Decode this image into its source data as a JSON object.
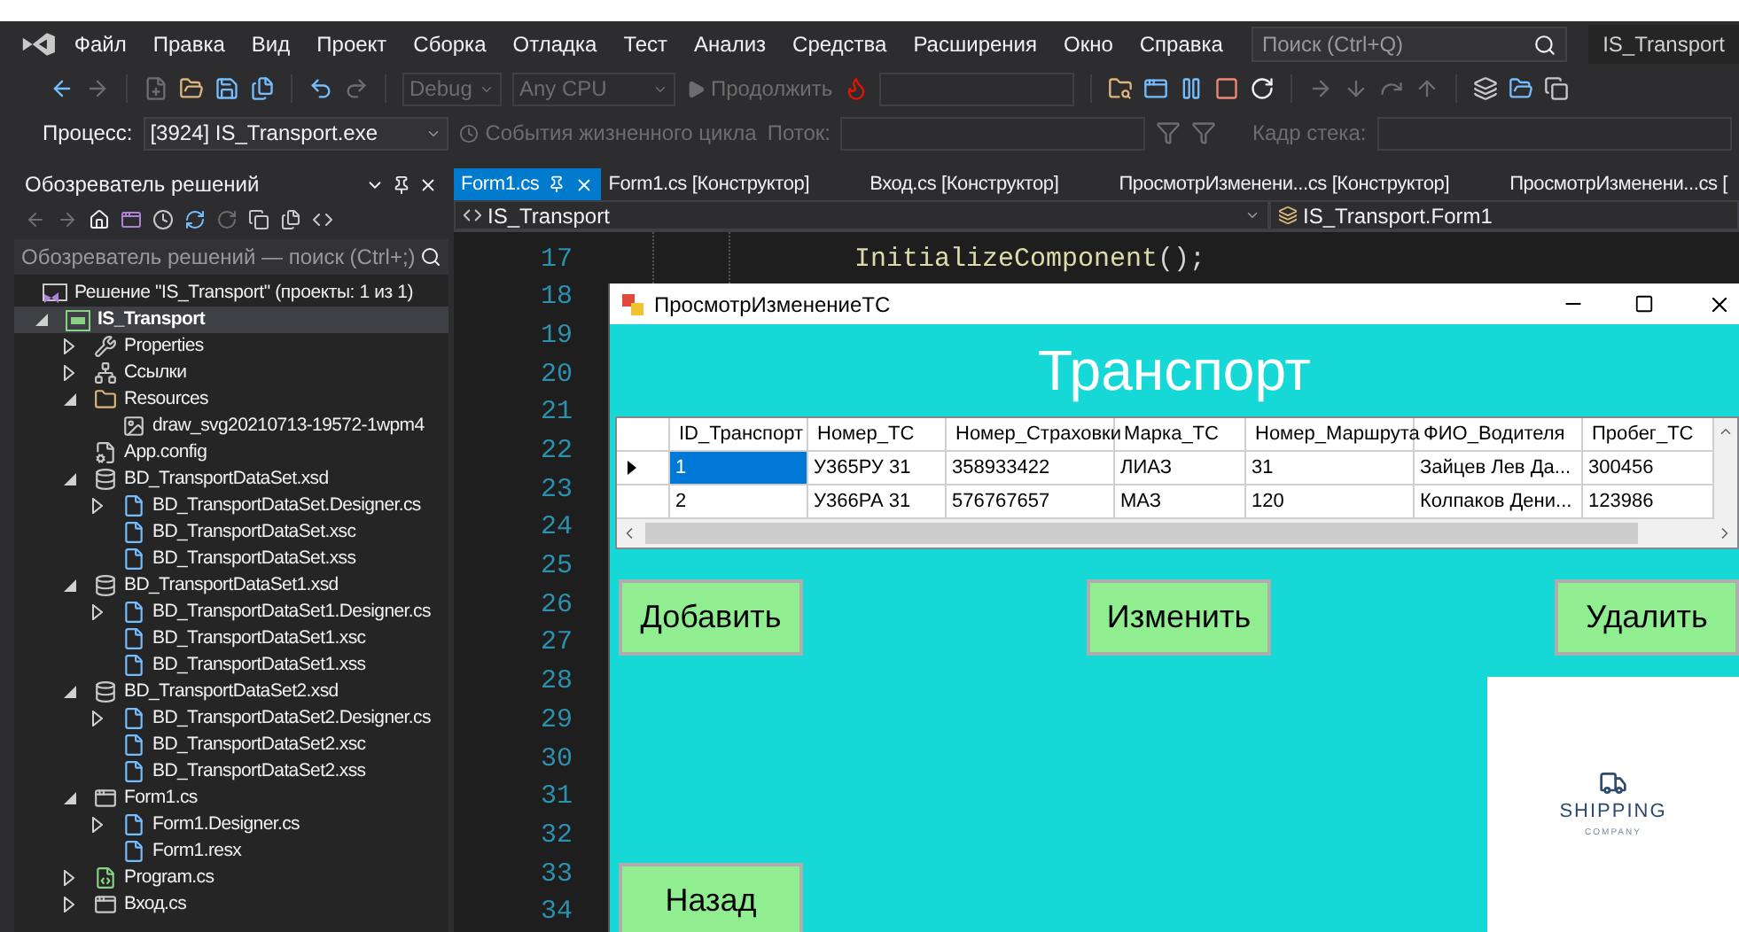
{
  "menu": {
    "items": [
      "Файл",
      "Правка",
      "Вид",
      "Проект",
      "Сборка",
      "Отладка",
      "Тест",
      "Анализ",
      "Средства",
      "Расширения",
      "Окно",
      "Справка"
    ],
    "search_placeholder": "Поиск (Ctrl+Q)",
    "solution_name": "IS_Transport"
  },
  "toolbar": {
    "configuration": "Debug",
    "platform": "Any CPU",
    "continue_label": "Продолжить"
  },
  "debug_bar": {
    "process_label": "Процесс:",
    "process": "[3924] IS_Transport.exe",
    "lifecycle_label": "События жизненного цикла",
    "thread_label": "Поток:",
    "stack_label": "Кадр стека:"
  },
  "solution_explorer": {
    "title": "Обозреватель решений",
    "search_placeholder": "Обозреватель решений — поиск (Ctrl+;)",
    "solution": "Решение \"IS_Transport\" (проекты: 1 из 1)",
    "tree": [
      {
        "label": "IS_Transport",
        "kind": "project",
        "expanded": true,
        "selected": true,
        "children": [
          {
            "label": "Properties",
            "kind": "properties",
            "expanded": false,
            "selected": false
          },
          {
            "label": "Ссылки",
            "kind": "references",
            "expanded": false,
            "selected": false
          },
          {
            "label": "Resources",
            "kind": "folder",
            "expanded": true,
            "selected": false,
            "children": [
              {
                "label": "draw_svg20210713-19572-1wpm4",
                "kind": "image",
                "selected": false
              }
            ]
          },
          {
            "label": "App.config",
            "kind": "config",
            "selected": false
          },
          {
            "label": "BD_TransportDataSet.xsd",
            "kind": "dataset",
            "expanded": true,
            "selected": false,
            "children": [
              {
                "label": "BD_TransportDataSet.Designer.cs",
                "kind": "file",
                "expanded": false,
                "selected": false
              },
              {
                "label": "BD_TransportDataSet.xsc",
                "kind": "file",
                "selected": false
              },
              {
                "label": "BD_TransportDataSet.xss",
                "kind": "file",
                "selected": false
              }
            ]
          },
          {
            "label": "BD_TransportDataSet1.xsd",
            "kind": "dataset",
            "expanded": true,
            "selected": false,
            "children": [
              {
                "label": "BD_TransportDataSet1.Designer.cs",
                "kind": "file",
                "expanded": false,
                "selected": false
              },
              {
                "label": "BD_TransportDataSet1.xsc",
                "kind": "file",
                "selected": false
              },
              {
                "label": "BD_TransportDataSet1.xss",
                "kind": "file",
                "selected": false
              }
            ]
          },
          {
            "label": "BD_TransportDataSet2.xsd",
            "kind": "dataset",
            "expanded": true,
            "selected": false,
            "children": [
              {
                "label": "BD_TransportDataSet2.Designer.cs",
                "kind": "file",
                "expanded": false,
                "selected": false
              },
              {
                "label": "BD_TransportDataSet2.xsc",
                "kind": "file",
                "selected": false
              },
              {
                "label": "BD_TransportDataSet2.xss",
                "kind": "file",
                "selected": false
              }
            ]
          },
          {
            "label": "Form1.cs",
            "kind": "form",
            "expanded": true,
            "selected": false,
            "children": [
              {
                "label": "Form1.Designer.cs",
                "kind": "file",
                "expanded": false,
                "selected": false
              },
              {
                "label": "Form1.resx",
                "kind": "file",
                "selected": false
              }
            ]
          },
          {
            "label": "Program.cs",
            "kind": "code",
            "expanded": false,
            "selected": false
          },
          {
            "label": "Вход.cs",
            "kind": "form",
            "expanded": false,
            "selected": false
          }
        ]
      }
    ]
  },
  "editor": {
    "tabs": [
      {
        "label": "Form1.cs",
        "selected": true
      },
      {
        "label": "Form1.cs [Конструктор]",
        "selected": false
      },
      {
        "label": "Вход.cs [Конструктор]",
        "selected": false
      },
      {
        "label": "ПросмотрИзменени...cs [Конструктор]",
        "selected": false
      },
      {
        "label": "ПросмотрИзменени...cs [",
        "selected": false
      }
    ],
    "project": "IS_Transport",
    "class": "IS_Transport.Form1",
    "lines": [
      {
        "number": "17",
        "tokens": [
          {
            "kind": "method",
            "text": "InitializeComponent"
          },
          {
            "kind": "punct",
            "text": "();"
          }
        ]
      },
      {
        "number": "18"
      },
      {
        "number": "19"
      },
      {
        "number": "20"
      },
      {
        "number": "21"
      },
      {
        "number": "22"
      },
      {
        "number": "23"
      },
      {
        "number": "24"
      },
      {
        "number": "25"
      },
      {
        "number": "26"
      },
      {
        "number": "27"
      },
      {
        "number": "28"
      },
      {
        "number": "29"
      },
      {
        "number": "30"
      },
      {
        "number": "31"
      },
      {
        "number": "32"
      },
      {
        "number": "33"
      },
      {
        "number": "34"
      }
    ]
  },
  "form_window": {
    "title": "ПросмотрИзменениеТС",
    "heading": "Транспорт",
    "grid": {
      "columns": [
        "ID_Транспорт",
        "Номер_ТС",
        "Номер_Страховки",
        "Марка_ТС",
        "Номер_Маршрута",
        "ФИО_Водителя",
        "Пробег_ТС"
      ],
      "rows": [
        {
          "current": true,
          "cells": [
            {
              "text": "1",
              "selected": true
            },
            {
              "text": "У365РУ 31",
              "selected": false
            },
            {
              "text": "358933422",
              "selected": false
            },
            {
              "text": "ЛИАЗ",
              "selected": false
            },
            {
              "text": "31",
              "selected": false
            },
            {
              "text": "Зайцев Лев Да...",
              "selected": false
            },
            {
              "text": "300456",
              "selected": false
            }
          ]
        },
        {
          "current": false,
          "cells": [
            {
              "text": "2",
              "selected": false
            },
            {
              "text": "У366РА 31",
              "selected": false
            },
            {
              "text": "576767657",
              "selected": false
            },
            {
              "text": "МАЗ",
              "selected": false
            },
            {
              "text": "120",
              "selected": false
            },
            {
              "text": "Колпаков Дени...",
              "selected": false
            },
            {
              "text": "123986",
              "selected": false
            }
          ]
        }
      ]
    },
    "buttons": [
      "Добавить",
      "Изменить",
      "Удалить"
    ],
    "back_button": "Назад",
    "logo": {
      "title": "SHIPPING",
      "subtitle": "COMPANY"
    }
  }
}
